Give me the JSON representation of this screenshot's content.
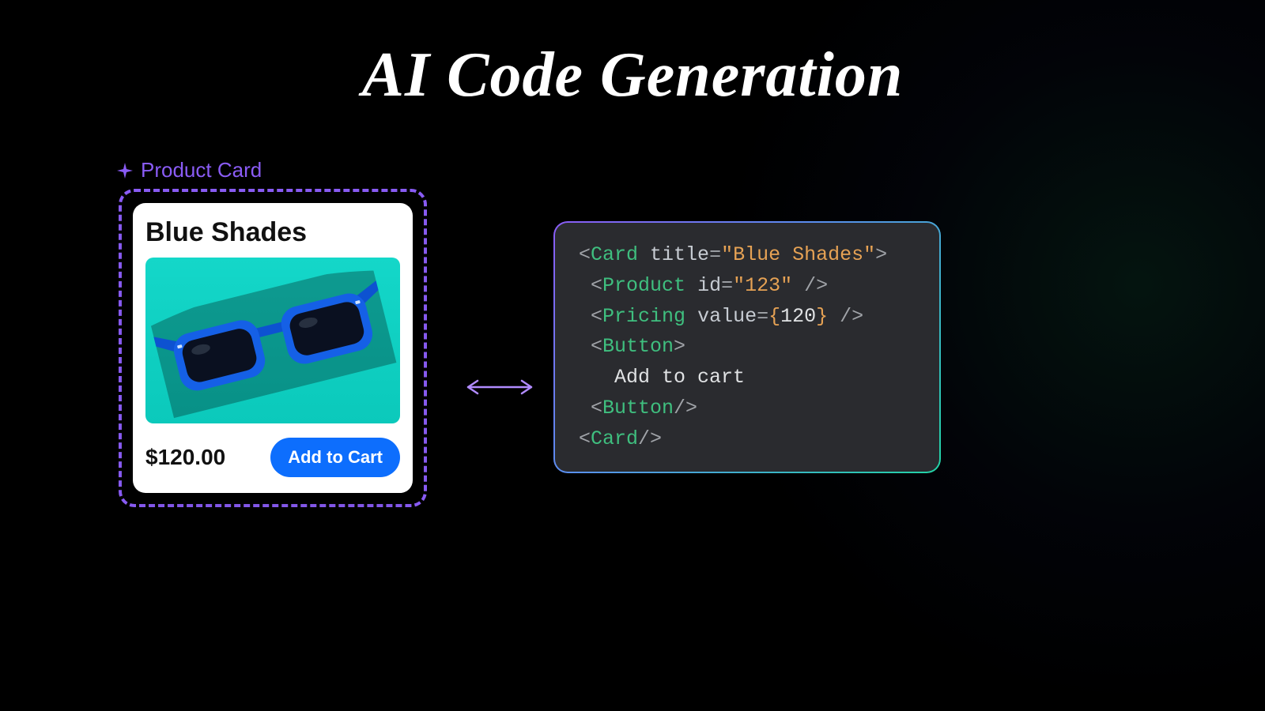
{
  "title": "AI Code Generation",
  "component": {
    "label": "Product Card",
    "card": {
      "title": "Blue Shades",
      "price": "$120.00",
      "button": "Add to Cart"
    }
  },
  "code": {
    "line1": {
      "tag": "Card",
      "attr": "title",
      "val": "\"Blue Shades\""
    },
    "line2": {
      "tag": "Product",
      "attr": "id",
      "val": "\"123\""
    },
    "line3": {
      "tag": "Pricing",
      "attr": "value",
      "num": "120"
    },
    "line4": {
      "tag": "Button"
    },
    "line5": {
      "text": "Add to cart"
    },
    "line6": {
      "tag": "Button"
    },
    "line7": {
      "tag": "Card"
    }
  }
}
